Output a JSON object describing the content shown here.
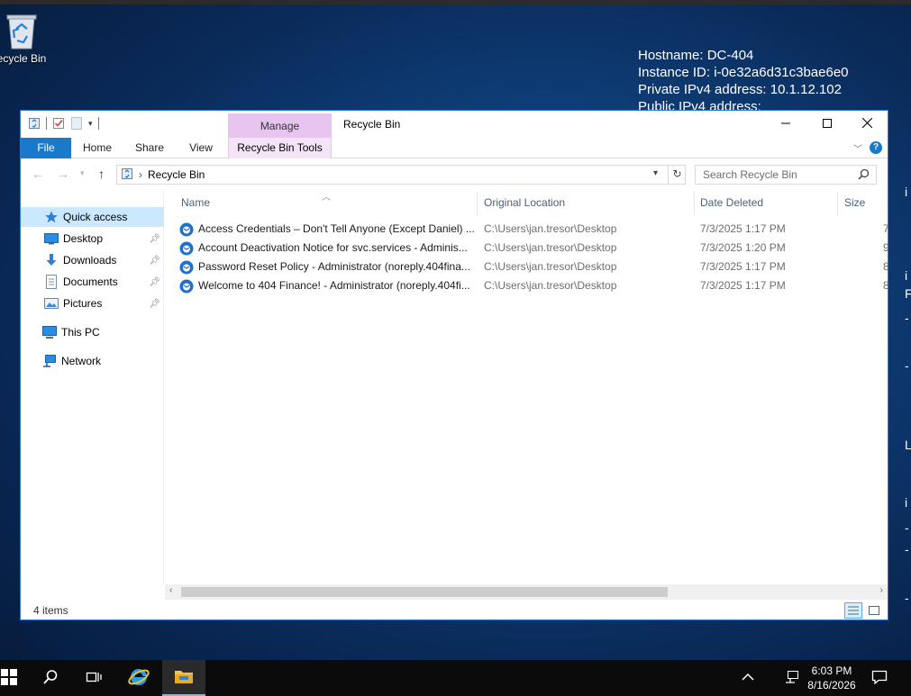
{
  "desktop": {
    "recycle_bin_label": "ecycle Bin",
    "bginfo": {
      "hostname": "Hostname: DC-404",
      "instance": "Instance ID: i-0e32a6d31c3bae6e0",
      "private_ip": "Private IPv4 address: 10.1.12.102",
      "public_ip": "Public IPv4 address:"
    },
    "side_marks": [
      "i",
      "i",
      "F",
      "-",
      "-",
      "L",
      "i",
      "-",
      "-",
      "-"
    ]
  },
  "window": {
    "title": "Recycle Bin",
    "manage_label": "Manage",
    "tabs": {
      "file": "File",
      "home": "Home",
      "share": "Share",
      "view": "View",
      "tools": "Recycle Bin Tools"
    },
    "help": "?",
    "address_path": "Recycle Bin",
    "search_placeholder": "Search Recycle Bin",
    "nav": {
      "quick_access": "Quick access",
      "desktop": "Desktop",
      "downloads": "Downloads",
      "documents": "Documents",
      "pictures": "Pictures",
      "this_pc": "This PC",
      "network": "Network"
    },
    "columns": {
      "name": "Name",
      "location": "Original Location",
      "date": "Date Deleted",
      "size": "Size"
    },
    "rows": [
      {
        "name": "Access Credentials – Don't Tell Anyone (Except Daniel) ...",
        "location": "C:\\Users\\jan.tresor\\Desktop",
        "date": "7/3/2025 1:17 PM",
        "size": "7"
      },
      {
        "name": "Account Deactivation Notice for svc.services - Adminis...",
        "location": "C:\\Users\\jan.tresor\\Desktop",
        "date": "7/3/2025 1:20 PM",
        "size": "9"
      },
      {
        "name": "Password Reset Policy - Administrator (noreply.404fina...",
        "location": "C:\\Users\\jan.tresor\\Desktop",
        "date": "7/3/2025 1:17 PM",
        "size": "8"
      },
      {
        "name": "Welcome to 404 Finance! - Administrator (noreply.404fi...",
        "location": "C:\\Users\\jan.tresor\\Desktop",
        "date": "7/3/2025 1:17 PM",
        "size": "8"
      }
    ],
    "status": "4 items"
  },
  "taskbar": {
    "time": "6:03 PM",
    "date": "8/16/2026"
  },
  "colors": {
    "accent": "#1979ca",
    "manage": "#e8c4f0",
    "selected": "#cce8ff"
  }
}
